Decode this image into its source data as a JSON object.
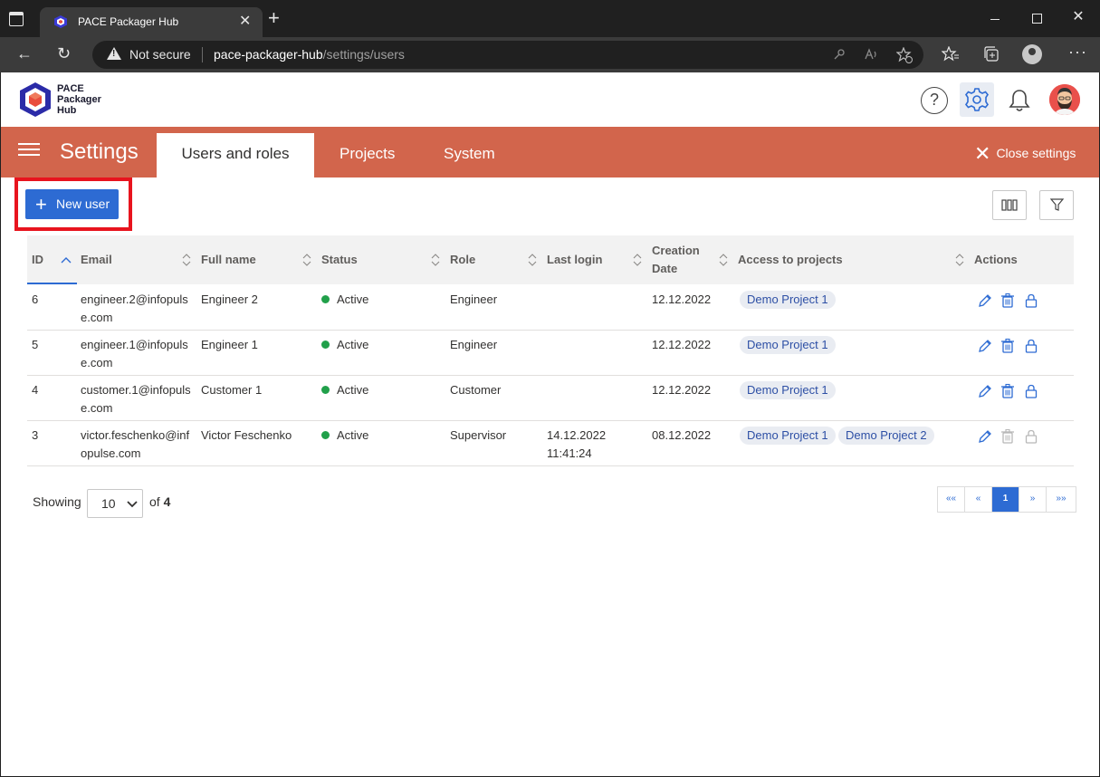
{
  "browser": {
    "tab_title": "PACE Packager Hub",
    "tab_close": "✕",
    "new_tab": "+",
    "not_secure": "Not secure",
    "url_host": "pace-packager-hub",
    "url_path": "/settings/users"
  },
  "app": {
    "logo_line1": "PACE",
    "logo_line2": "Packager",
    "logo_line3": "Hub",
    "help": "?"
  },
  "settings_bar": {
    "title": "Settings",
    "tabs": [
      {
        "label": "Users and roles"
      },
      {
        "label": "Projects"
      },
      {
        "label": "System"
      }
    ],
    "close_label": "Close settings",
    "close_x": "✕"
  },
  "toolbar": {
    "new_user_plus": "+",
    "new_user_label": "New user"
  },
  "table": {
    "headers": {
      "id": "ID",
      "email": "Email",
      "full_name": "Full name",
      "status": "Status",
      "role": "Role",
      "last_login": "Last login",
      "creation_line1": "Creation",
      "creation_line2": "Date",
      "access": "Access to projects",
      "actions": "Actions"
    },
    "rows": [
      {
        "id": "6",
        "email1": "engineer.2@infopuls",
        "email2": "e.com",
        "full_name": "Engineer 2",
        "status": "Active",
        "role": "Engineer",
        "login1": "",
        "login2": "",
        "created": "12.12.2022",
        "projects": [
          "Demo Project 1"
        ]
      },
      {
        "id": "5",
        "email1": "engineer.1@infopuls",
        "email2": "e.com",
        "full_name": "Engineer 1",
        "status": "Active",
        "role": "Engineer",
        "login1": "",
        "login2": "",
        "created": "12.12.2022",
        "projects": [
          "Demo Project 1"
        ]
      },
      {
        "id": "4",
        "email1": "customer.1@infopuls",
        "email2": "e.com",
        "full_name": "Customer 1",
        "status": "Active",
        "role": "Customer",
        "login1": "",
        "login2": "",
        "created": "12.12.2022",
        "projects": [
          "Demo Project 1"
        ]
      },
      {
        "id": "3",
        "email1": "victor.feschenko@inf",
        "email2": "opulse.com",
        "full_name": "Victor Feschenko",
        "status": "Active",
        "role": "Supervisor",
        "login1": "14.12.2022",
        "login2": "11:41:24",
        "created": "08.12.2022",
        "projects": [
          "Demo Project 1",
          "Demo Project 2"
        ]
      }
    ]
  },
  "pagination": {
    "showing_label": "Showing",
    "page_size": "10",
    "of_label": "of",
    "total": "4",
    "first": "««",
    "prev": "«",
    "current": "1",
    "next": "»",
    "last": "»»"
  },
  "colors": {
    "accent": "#2d6bd3",
    "settings_bar": "#d2654c",
    "status_active": "#21a04a",
    "highlight": "#e8141e"
  }
}
